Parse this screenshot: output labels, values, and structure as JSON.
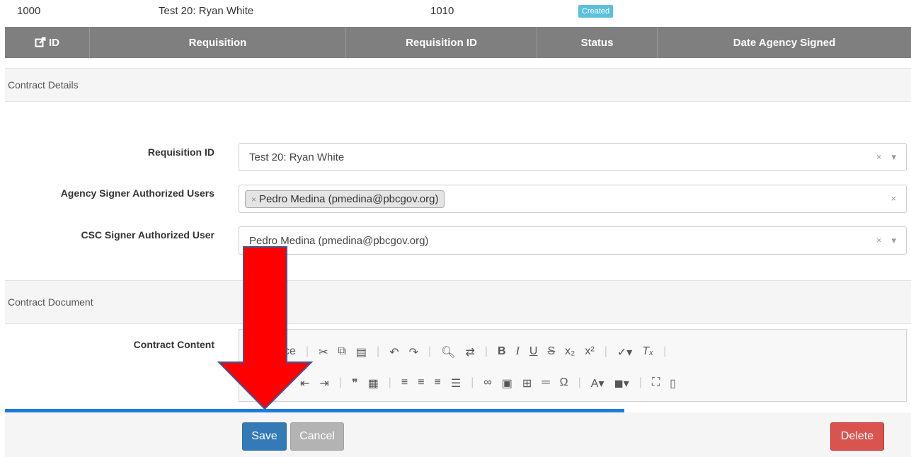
{
  "top_row": {
    "id": "1000",
    "requisition": "Test 20: Ryan White",
    "requisition_id": "1010",
    "status": "Created"
  },
  "table_header": {
    "id": "ID",
    "requisition": "Requisition",
    "requisition_id": "Requisition ID",
    "status": "Status",
    "date_signed": "Date Agency Signed"
  },
  "contract_details": {
    "title": "Contract Details",
    "requisition_label": "Requisition ID",
    "requisition_value": "Test 20: Ryan White",
    "agency_label": "Agency Signer Authorized Users",
    "agency_tag": "Pedro Medina (pmedina@pbcgov.org)",
    "csc_label": "CSC Signer Authorized User",
    "csc_value": "Pedro Medina (pmedina@pbcgov.org)"
  },
  "contract_document": {
    "title": "Contract Document",
    "content_label": "Contract Content",
    "toolbar_source_label": "ce"
  },
  "buttons": {
    "save": "Save",
    "cancel": "Cancel",
    "delete": "Delete"
  },
  "colors": {
    "header_bg": "#7f7f7f",
    "badge": "#5bc0de",
    "save": "#337ab7",
    "delete": "#d9534f",
    "arrow": "#ff0000",
    "progress": "#1e7be0"
  },
  "icons": [
    "edit-icon",
    "clear-icon",
    "dropdown-caret-icon",
    "cut-icon",
    "copy-icon",
    "paste-icon",
    "undo-icon",
    "redo-icon",
    "find-icon",
    "replace-icon",
    "bold-icon",
    "italic-icon",
    "underline-icon",
    "strike-icon",
    "subscript-icon",
    "superscript-icon",
    "spellcheck-icon",
    "remove-format-icon",
    "indent-icon",
    "outdent-icon",
    "blockquote-icon",
    "div-icon",
    "align-left-icon",
    "align-center-icon",
    "align-right-icon",
    "justify-icon",
    "link-icon",
    "image-icon",
    "table-icon",
    "hr-icon",
    "special-char-icon",
    "text-color-icon",
    "bg-color-icon",
    "maximize-icon",
    "show-blocks-icon",
    "down-arrow-annotation"
  ]
}
